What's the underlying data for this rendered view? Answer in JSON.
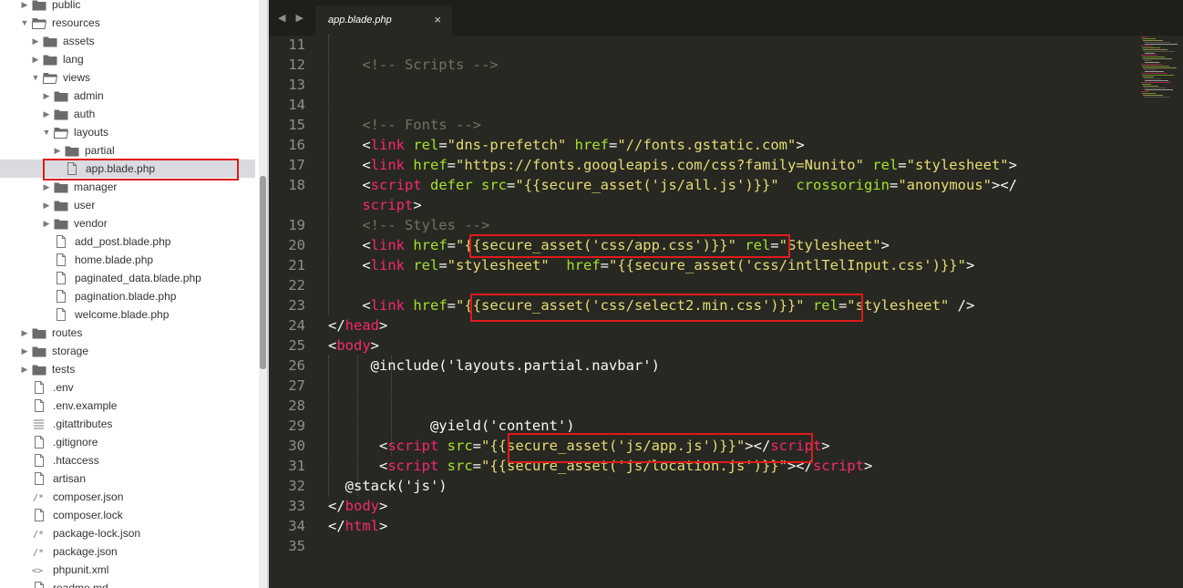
{
  "sidebar": {
    "items": [
      {
        "label": "public",
        "type": "folder",
        "depth": 1,
        "expanded": false,
        "arrow": "right"
      },
      {
        "label": "resources",
        "type": "folder",
        "depth": 1,
        "expanded": true,
        "arrow": "down"
      },
      {
        "label": "assets",
        "type": "folder",
        "depth": 2,
        "arrow": "right"
      },
      {
        "label": "lang",
        "type": "folder",
        "depth": 2,
        "arrow": "right"
      },
      {
        "label": "views",
        "type": "folder",
        "depth": 2,
        "expanded": true,
        "arrow": "down"
      },
      {
        "label": "admin",
        "type": "folder",
        "depth": 3,
        "arrow": "right"
      },
      {
        "label": "auth",
        "type": "folder",
        "depth": 3,
        "arrow": "right"
      },
      {
        "label": "layouts",
        "type": "folder",
        "depth": 3,
        "expanded": true,
        "arrow": "down"
      },
      {
        "label": "partial",
        "type": "folder",
        "depth": 4,
        "arrow": "right"
      },
      {
        "label": "app.blade.php",
        "type": "file",
        "depth": 4,
        "selected": true
      },
      {
        "label": "manager",
        "type": "folder",
        "depth": 3,
        "arrow": "right"
      },
      {
        "label": "user",
        "type": "folder",
        "depth": 3,
        "arrow": "right"
      },
      {
        "label": "vendor",
        "type": "folder",
        "depth": 3,
        "arrow": "right"
      },
      {
        "label": "add_post.blade.php",
        "type": "file",
        "depth": 3
      },
      {
        "label": "home.blade.php",
        "type": "file",
        "depth": 3
      },
      {
        "label": "paginated_data.blade.php",
        "type": "file",
        "depth": 3
      },
      {
        "label": "pagination.blade.php",
        "type": "file",
        "depth": 3
      },
      {
        "label": "welcome.blade.php",
        "type": "file",
        "depth": 3
      },
      {
        "label": "routes",
        "type": "folder",
        "depth": 1,
        "arrow": "right"
      },
      {
        "label": "storage",
        "type": "folder",
        "depth": 1,
        "arrow": "right"
      },
      {
        "label": "tests",
        "type": "folder",
        "depth": 1,
        "arrow": "right"
      },
      {
        "label": ".env",
        "type": "file",
        "depth": 2
      },
      {
        "label": ".env.example",
        "type": "file",
        "depth": 2
      },
      {
        "label": ".gitattributes",
        "type": "lines",
        "depth": 2
      },
      {
        "label": ".gitignore",
        "type": "file",
        "depth": 2
      },
      {
        "label": ".htaccess",
        "type": "file",
        "depth": 2
      },
      {
        "label": "artisan",
        "type": "file",
        "depth": 2
      },
      {
        "label": "composer.json",
        "type": "json",
        "depth": 2
      },
      {
        "label": "composer.lock",
        "type": "file",
        "depth": 2
      },
      {
        "label": "package-lock.json",
        "type": "json",
        "depth": 2
      },
      {
        "label": "package.json",
        "type": "json",
        "depth": 2
      },
      {
        "label": "phpunit.xml",
        "type": "xml",
        "depth": 2
      },
      {
        "label": "readme.md",
        "type": "file",
        "depth": 2
      }
    ]
  },
  "tabbar": {
    "nav_label": "◀ ▶",
    "tab_title": "app.blade.php",
    "close_label": "×"
  },
  "editor": {
    "line_numbers": [
      "11",
      "12",
      "13",
      "14",
      "15",
      "16",
      "17",
      "18",
      "",
      "19",
      "20",
      "21",
      "22",
      "23",
      "24",
      "25",
      "26",
      "27",
      "28",
      "29",
      "30",
      "31",
      "32",
      "33",
      "34",
      "35"
    ],
    "lines": [
      {
        "indent": 0,
        "tokens": []
      },
      {
        "indent": 2,
        "tokens": [
          [
            "cmt",
            "<!-- Scripts -->"
          ]
        ]
      },
      {
        "indent": 0,
        "tokens": []
      },
      {
        "indent": 0,
        "tokens": []
      },
      {
        "indent": 2,
        "tokens": [
          [
            "cmt",
            "<!-- Fonts -->"
          ]
        ]
      },
      {
        "indent": 2,
        "tokens": [
          [
            "txt",
            "<"
          ],
          [
            "tag",
            "link"
          ],
          [
            "txt",
            " "
          ],
          [
            "attr",
            "rel"
          ],
          [
            "txt",
            "="
          ],
          [
            "str",
            "\"dns-prefetch\""
          ],
          [
            "txt",
            " "
          ],
          [
            "attr",
            "href"
          ],
          [
            "txt",
            "="
          ],
          [
            "str",
            "\"//fonts.gstatic.com\""
          ],
          [
            "txt",
            ">"
          ]
        ]
      },
      {
        "indent": 2,
        "tokens": [
          [
            "txt",
            "<"
          ],
          [
            "tag",
            "link"
          ],
          [
            "txt",
            " "
          ],
          [
            "attr",
            "href"
          ],
          [
            "txt",
            "="
          ],
          [
            "str",
            "\"https://fonts.googleapis.com/css?family=Nunito\""
          ],
          [
            "txt",
            " "
          ],
          [
            "attr",
            "rel"
          ],
          [
            "txt",
            "="
          ],
          [
            "str",
            "\"stylesheet\""
          ],
          [
            "txt",
            ">"
          ]
        ]
      },
      {
        "indent": 2,
        "tokens": [
          [
            "txt",
            "<"
          ],
          [
            "tag",
            "script"
          ],
          [
            "txt",
            " "
          ],
          [
            "attr",
            "defer"
          ],
          [
            "txt",
            " "
          ],
          [
            "attr",
            "src"
          ],
          [
            "txt",
            "="
          ],
          [
            "str",
            "\"{{secure_asset('js/all.js')}}\""
          ],
          [
            "txt",
            "  "
          ],
          [
            "attr",
            "crossorigin"
          ],
          [
            "txt",
            "="
          ],
          [
            "str",
            "\"anonymous\""
          ],
          [
            "txt",
            "></"
          ]
        ]
      },
      {
        "indent": 2,
        "tokens": [
          [
            "tag",
            "script"
          ],
          [
            "txt",
            ">"
          ]
        ]
      },
      {
        "indent": 2,
        "tokens": [
          [
            "cmt",
            "<!-- Styles -->"
          ]
        ]
      },
      {
        "indent": 2,
        "tokens": [
          [
            "txt",
            "<"
          ],
          [
            "tag",
            "link"
          ],
          [
            "txt",
            " "
          ],
          [
            "attr",
            "href"
          ],
          [
            "txt",
            "="
          ],
          [
            "str",
            "\"{{secure_asset('css/app.css')}}\""
          ],
          [
            "txt",
            " "
          ],
          [
            "attr",
            "rel"
          ],
          [
            "txt",
            "="
          ],
          [
            "str",
            "\"Stylesheet\""
          ],
          [
            "txt",
            ">"
          ]
        ]
      },
      {
        "indent": 2,
        "tokens": [
          [
            "txt",
            "<"
          ],
          [
            "tag",
            "link"
          ],
          [
            "txt",
            " "
          ],
          [
            "attr",
            "rel"
          ],
          [
            "txt",
            "="
          ],
          [
            "str",
            "\"stylesheet\""
          ],
          [
            "txt",
            "  "
          ],
          [
            "attr",
            "href"
          ],
          [
            "txt",
            "="
          ],
          [
            "str",
            "\"{{secure_asset('css/intlTelInput.css')}}\""
          ],
          [
            "txt",
            ">"
          ]
        ]
      },
      {
        "indent": 0,
        "tokens": []
      },
      {
        "indent": 2,
        "tokens": [
          [
            "txt",
            "<"
          ],
          [
            "tag",
            "link"
          ],
          [
            "txt",
            " "
          ],
          [
            "attr",
            "href"
          ],
          [
            "txt",
            "="
          ],
          [
            "str",
            "\"{{secure_asset('css/select2.min.css')}}\""
          ],
          [
            "txt",
            " "
          ],
          [
            "attr",
            "rel"
          ],
          [
            "txt",
            "="
          ],
          [
            "str",
            "\"stylesheet\""
          ],
          [
            "txt",
            " />"
          ]
        ]
      },
      {
        "indent": 0,
        "tokens": [
          [
            "txt",
            "</"
          ],
          [
            "tag",
            "head"
          ],
          [
            "txt",
            ">"
          ]
        ]
      },
      {
        "indent": 0,
        "tokens": [
          [
            "txt",
            "<"
          ],
          [
            "tag",
            "body"
          ],
          [
            "txt",
            ">"
          ]
        ]
      },
      {
        "indent": 2.5,
        "tokens": [
          [
            "txt",
            "@include('layouts.partial.navbar')"
          ]
        ]
      },
      {
        "indent": 0,
        "tokens": []
      },
      {
        "indent": 0,
        "tokens": []
      },
      {
        "indent": 6,
        "tokens": [
          [
            "txt",
            "@yield('content')"
          ]
        ]
      },
      {
        "indent": 3,
        "tokens": [
          [
            "txt",
            "<"
          ],
          [
            "tag",
            "script"
          ],
          [
            "txt",
            " "
          ],
          [
            "attr",
            "src"
          ],
          [
            "txt",
            "="
          ],
          [
            "str",
            "\"{{secure_asset('js/app.js')}}\""
          ],
          [
            "txt",
            "></"
          ],
          [
            "tag",
            "script"
          ],
          [
            "txt",
            ">"
          ]
        ]
      },
      {
        "indent": 3,
        "tokens": [
          [
            "txt",
            "<"
          ],
          [
            "tag",
            "script"
          ],
          [
            "txt",
            " "
          ],
          [
            "attr",
            "src"
          ],
          [
            "txt",
            "="
          ],
          [
            "str",
            "\"{{secure_asset('js/location.js')}}\""
          ],
          [
            "txt",
            "></"
          ],
          [
            "tag",
            "script"
          ],
          [
            "txt",
            ">"
          ]
        ]
      },
      {
        "indent": 1,
        "tokens": [
          [
            "txt",
            "@stack('js')"
          ]
        ]
      },
      {
        "indent": 0,
        "tokens": [
          [
            "txt",
            "</"
          ],
          [
            "tag",
            "body"
          ],
          [
            "txt",
            ">"
          ]
        ]
      },
      {
        "indent": 0,
        "tokens": [
          [
            "txt",
            "</"
          ],
          [
            "tag",
            "html"
          ],
          [
            "txt",
            ">"
          ]
        ]
      },
      {
        "indent": 0,
        "tokens": []
      }
    ]
  },
  "colors": {
    "editor_bg": "#272822",
    "tag": "#f92672",
    "attr": "#a6e22e",
    "string": "#e6db74",
    "comment": "#75715e",
    "highlight_box": "#e01a1a"
  }
}
